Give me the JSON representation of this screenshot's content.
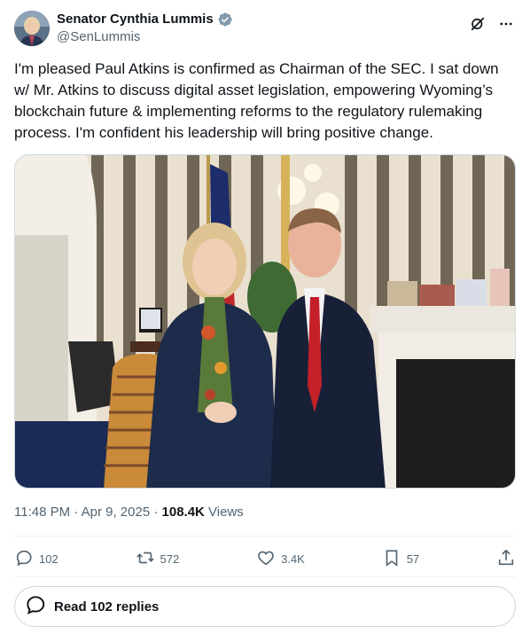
{
  "author": {
    "display_name": "Senator Cynthia Lummis",
    "handle": "@SenLummis"
  },
  "header_icons": [
    "grok-icon",
    "more-icon"
  ],
  "tweet": {
    "text": "I'm pleased Paul Atkins is confirmed as Chairman of the SEC. I sat down w/ Mr. Atkins to discuss digital asset legislation, empowering Wyoming’s blockchain future & implementing reforms to the regulatory rulemaking process. I'm confident his leadership will bring positive change."
  },
  "meta": {
    "time": "11:48 PM",
    "sep1": " · ",
    "date": "Apr 9, 2025",
    "sep2": " · ",
    "views_count": "108.4K",
    "views_label": " Views"
  },
  "actions": {
    "replies": "102",
    "reposts": "572",
    "likes": "3.4K",
    "bookmarks": "57"
  },
  "read_replies": "Read 102 replies",
  "colors": {
    "text": "#0f1419",
    "muted": "#536471",
    "verified": "#829aab",
    "border": "#cfd9de"
  }
}
